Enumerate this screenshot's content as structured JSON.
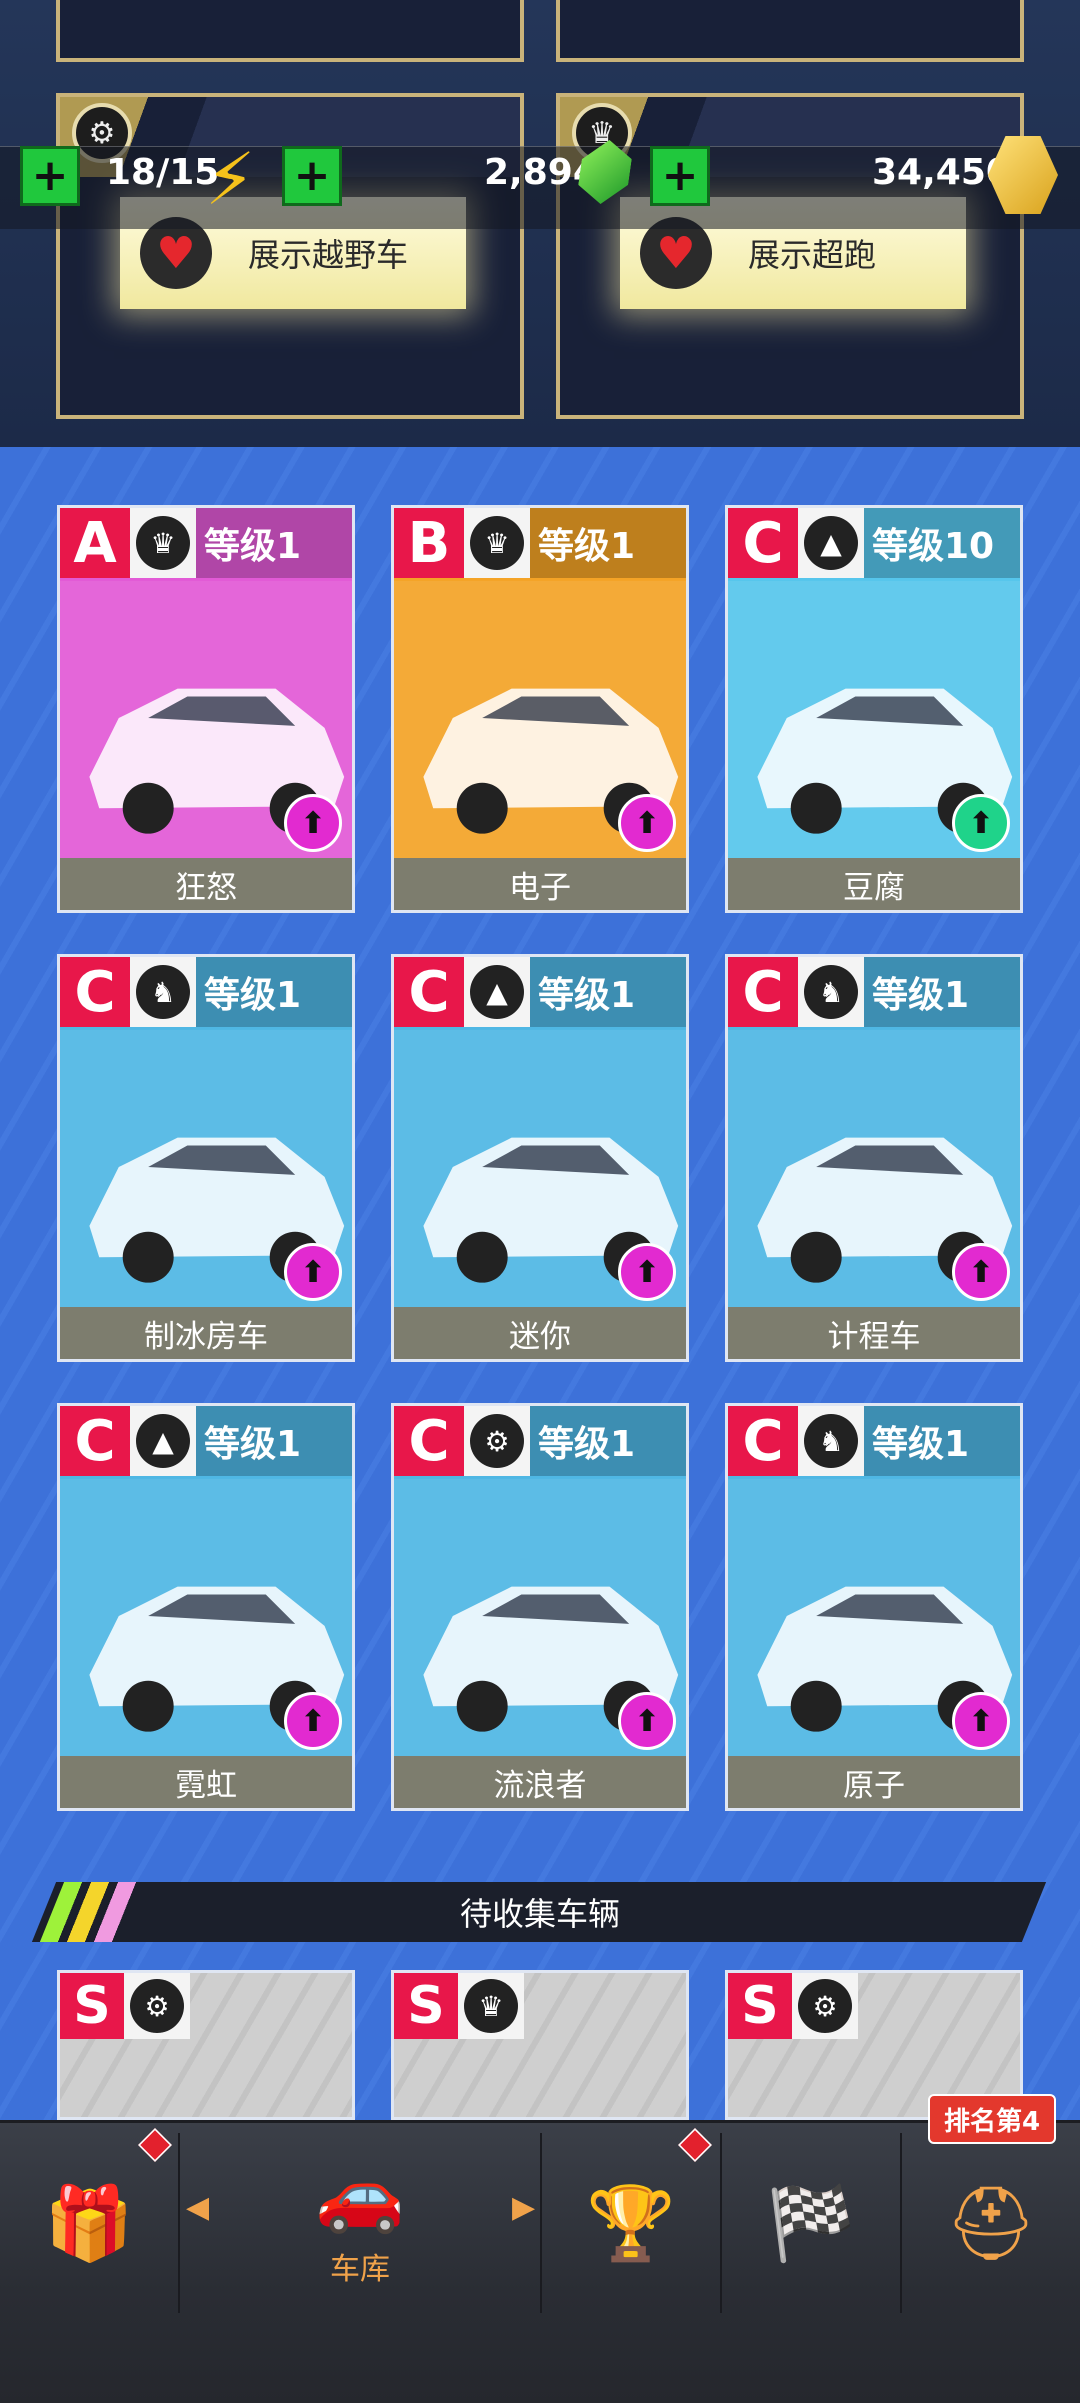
{
  "header": {
    "cards": [
      {
        "show_label": "展示越野车",
        "icon": "wheel-icon"
      },
      {
        "show_label": "展示超跑",
        "icon": "crown-icon"
      }
    ]
  },
  "resources": {
    "energy": "18/15",
    "gems": "2,894",
    "coins": "34,450"
  },
  "cars": [
    {
      "class": "A",
      "type_icon": "crown-icon",
      "level": "等级1",
      "name": "狂怒",
      "bg": "#e25ad6",
      "upgrade": "#e22ad0"
    },
    {
      "class": "B",
      "type_icon": "crown-icon",
      "level": "等级1",
      "name": "电子",
      "bg": "#f4a326",
      "upgrade": "#e22ad0"
    },
    {
      "class": "C",
      "type_icon": "road-icon",
      "level": "等级10",
      "name": "豆腐",
      "bg": "#56c6ec",
      "upgrade": "#1fd38a"
    },
    {
      "class": "C",
      "type_icon": "horse-icon",
      "level": "等级1",
      "name": "制冰房车",
      "bg": "#4fb7e4",
      "upgrade": "#e22ad0"
    },
    {
      "class": "C",
      "type_icon": "road-icon",
      "level": "等级1",
      "name": "迷你",
      "bg": "#4fb7e4",
      "upgrade": "#e22ad0"
    },
    {
      "class": "C",
      "type_icon": "horse-icon",
      "level": "等级1",
      "name": "计程车",
      "bg": "#4fb7e4",
      "upgrade": "#e22ad0"
    },
    {
      "class": "C",
      "type_icon": "road-icon",
      "level": "等级1",
      "name": "霓虹",
      "bg": "#4fb7e4",
      "upgrade": "#e22ad0"
    },
    {
      "class": "C",
      "type_icon": "wheel-icon",
      "level": "等级1",
      "name": "流浪者",
      "bg": "#4fb7e4",
      "upgrade": "#e22ad0"
    },
    {
      "class": "C",
      "type_icon": "horse-icon",
      "level": "等级1",
      "name": "原子",
      "bg": "#4fb7e4",
      "upgrade": "#e22ad0"
    }
  ],
  "section": {
    "title": "待收集车辆"
  },
  "locked": [
    {
      "class": "S",
      "type_icon": "wheel-icon"
    },
    {
      "class": "S",
      "type_icon": "crown-icon"
    },
    {
      "class": "S",
      "type_icon": "wheel-icon"
    }
  ],
  "nav": {
    "garage_label": "车库",
    "rank_badge": "排名第4"
  }
}
